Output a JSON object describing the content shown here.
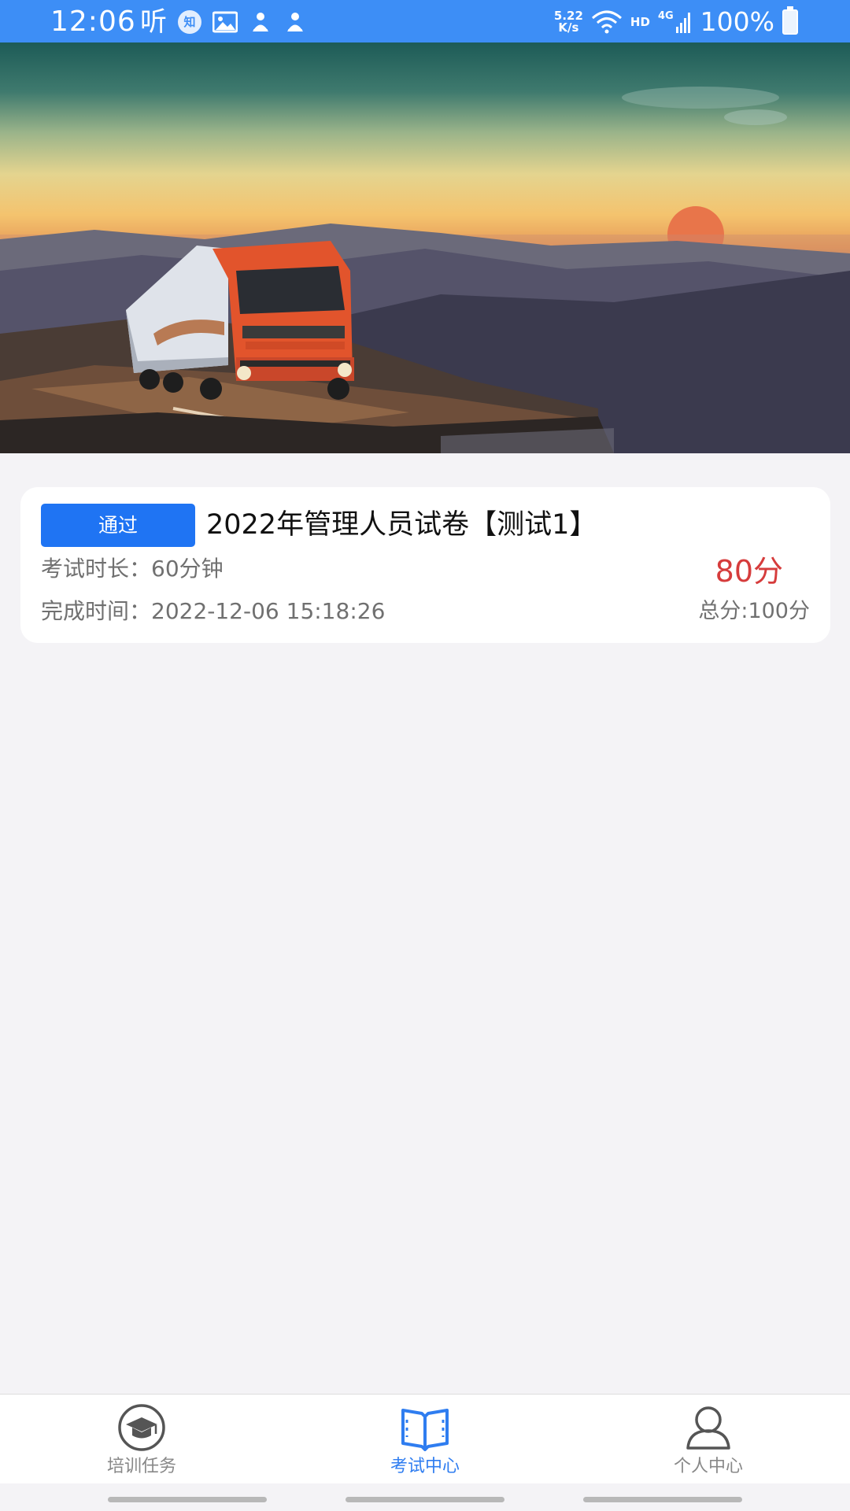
{
  "status_bar": {
    "time": "12:06",
    "ting_glyph": "听",
    "zhi_badge": "知",
    "net_speed_value": "5.22",
    "net_speed_unit": "K/s",
    "hd_label": "HD",
    "network_label": "4G",
    "battery": "100%",
    "icons": [
      "image-icon",
      "notification-icon",
      "notification-icon",
      "wifi-icon",
      "signal-icon",
      "battery-charging-icon"
    ]
  },
  "banner": {
    "description_icon": "truck-sunset-banner-image"
  },
  "exam_card": {
    "status_badge": "通过",
    "title": "2022年管理人员试卷【测试1】",
    "duration": "考试时长：60分钟",
    "finish_time": "完成时间：2022-12-06 15:18:26",
    "score": "80分",
    "total": "总分:100分"
  },
  "tab_bar": {
    "tabs": [
      {
        "label": "培训任务",
        "icon": "graduation-cap-icon",
        "active": false
      },
      {
        "label": "考试中心",
        "icon": "open-book-icon",
        "active": true
      },
      {
        "label": "个人中心",
        "icon": "person-icon",
        "active": false
      }
    ]
  },
  "colors": {
    "status_bar": "#3d8ef6",
    "badge": "#1f74f3",
    "score": "#d63c3c",
    "active_tab": "#2f7df0",
    "inactive_tab": "#888888",
    "page_background": "#f4f3f6"
  }
}
